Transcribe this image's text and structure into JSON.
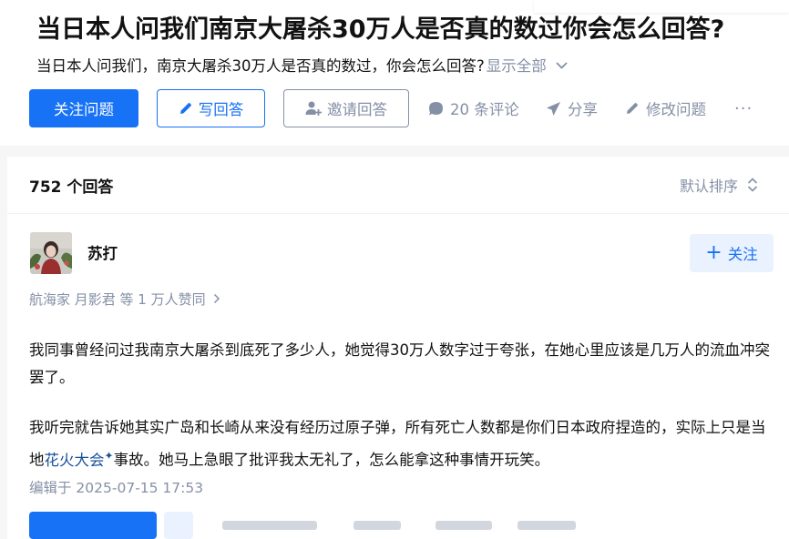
{
  "question": {
    "title": "当日本人问我们南京大屠杀30万人是否真的数过你会怎么回答?",
    "description": "当日本人问我们，南京大屠杀30万人是否真的数过，你会怎么回答?",
    "show_all": "显示全部",
    "buttons": {
      "follow": "关注问题",
      "write": "写回答",
      "invite": "邀请回答"
    },
    "actions": {
      "comments": "20 条评论",
      "share": "分享",
      "edit": "修改问题",
      "more": "···"
    }
  },
  "answers": {
    "count_label": "752 个回答",
    "sort_label": "默认排序",
    "first": {
      "author": "苏打",
      "follow_label": "关注",
      "voters": "航海家 月影君 等 1 万人赞同",
      "paragraph1": "我同事曾经问过我南京大屠杀到底死了多少人，她觉得30万人数字过于夸张，在她心里应该是几万人的流血冲突罢了。",
      "paragraph2_before": "我听完就告诉她其实广岛和长崎从来没有经历过原子弹，所有死亡人数都是你们日本政府捏造的，实际上只是当地",
      "paragraph2_link": "花火大会",
      "paragraph2_after": "事故。她马上急眼了批评我太无礼了，怎么能拿这种事情开玩笑。",
      "edited": "编辑于 2025-07-15 17:53"
    }
  },
  "colors": {
    "brand_blue": "#1772f6",
    "light_blue_bg": "#eaf2ff",
    "muted_gray": "#8590a6",
    "link_blue": "#175199"
  },
  "icons": [
    "pencil-icon",
    "invite-user-icon",
    "comment-bubble-icon",
    "paper-plane-icon",
    "edit-pencil-icon",
    "more-icon",
    "sort-arrows-icon",
    "chevron-down-icon",
    "plus-icon",
    "sparkle-icon",
    "chevron-right-icon"
  ]
}
